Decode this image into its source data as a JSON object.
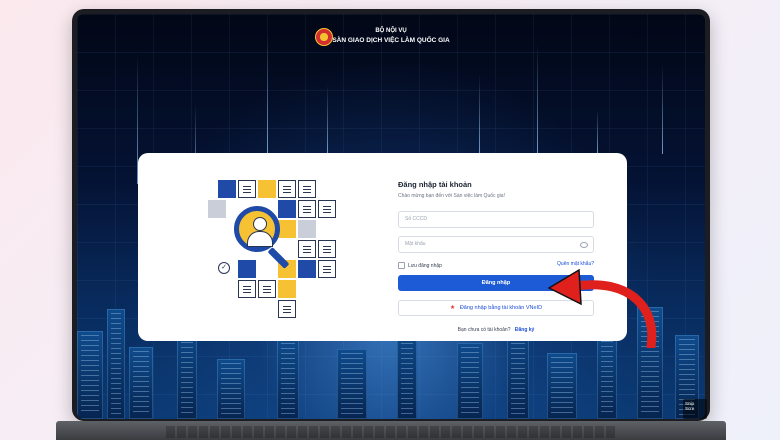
{
  "header": {
    "ministry": "BỘ NỘI VỤ",
    "exchange_name": "SÀN GIAO DỊCH VIỆC LÀM QUỐC GIA"
  },
  "login": {
    "title": "Đăng nhập tài khoản",
    "subtitle": "Chào mừng bạn đến với Sàn việc làm Quốc gia!",
    "account_placeholder": "Số CCCD",
    "password_placeholder": "Mật khẩu",
    "remember_label": "Lưu đăng nhập",
    "forgot_link": "Quên mật khẩu?",
    "login_button": "Đăng nhập",
    "vneid_button": "Đăng nhập bằng tài khoản VNeID",
    "no_account_text": "Bạn chưa có tài khoản?",
    "signup_link": "Đăng ký"
  },
  "corner_widget": {
    "line1": "Snip",
    "line2": "Scre"
  },
  "icons": [
    "national-emblem-icon",
    "eye-icon",
    "star-icon",
    "checkmark-icon",
    "magnifier-icon"
  ],
  "colors": {
    "primary": "#1d5bd6",
    "link": "#1d4ed8",
    "accent_yellow": "#f6c133",
    "arrow_red": "#e0201c"
  }
}
